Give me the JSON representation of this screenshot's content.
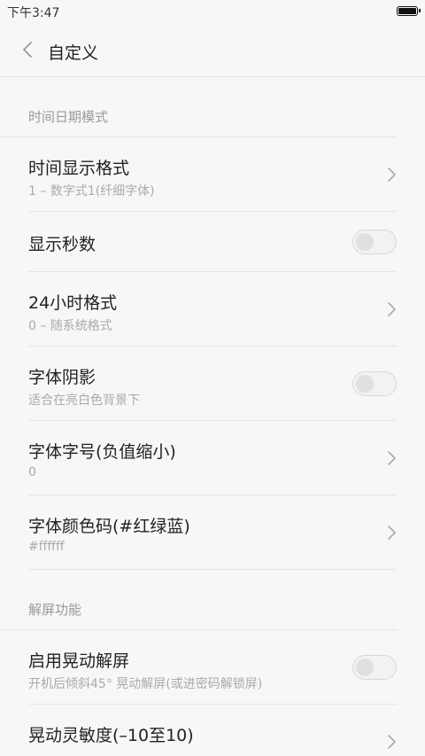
{
  "status_bar": {
    "time": "下午3:47"
  },
  "header": {
    "title": "自定义"
  },
  "sections": [
    {
      "title": "时间日期模式",
      "rows": [
        {
          "title": "时间显示格式",
          "subtitle": "1 – 数字式1(纤细字体)",
          "control": "chevron"
        },
        {
          "title": "显示秒数",
          "subtitle": "",
          "control": "toggle",
          "toggle_on": false
        },
        {
          "title": "24小时格式",
          "subtitle": "0 – 随系统格式",
          "control": "chevron"
        },
        {
          "title": "字体阴影",
          "subtitle": "适合在亮白色背景下",
          "control": "toggle",
          "toggle_on": false
        },
        {
          "title": "字体字号(负值缩小)",
          "subtitle": "0",
          "control": "chevron"
        },
        {
          "title": "字体颜色码(#红绿蓝)",
          "subtitle": "#ffffff",
          "control": "chevron"
        }
      ]
    },
    {
      "title": "解屏功能",
      "rows": [
        {
          "title": "启用晃动解屏",
          "subtitle": "开机后倾斜45°  晃动解屏(或进密码解锁屏)",
          "control": "toggle",
          "toggle_on": false
        },
        {
          "title": "晃动灵敏度(–10至10)",
          "subtitle": "",
          "control": "chevron"
        }
      ]
    }
  ],
  "icons": {
    "back": "back-chevron-icon",
    "row_arrow": "chevron-right-icon",
    "battery": "battery-icon"
  },
  "colors": {
    "background": "#f7f7f7",
    "divider": "#e5e5e5",
    "primary_text": "#222222",
    "secondary_text": "#aaaaaa"
  }
}
